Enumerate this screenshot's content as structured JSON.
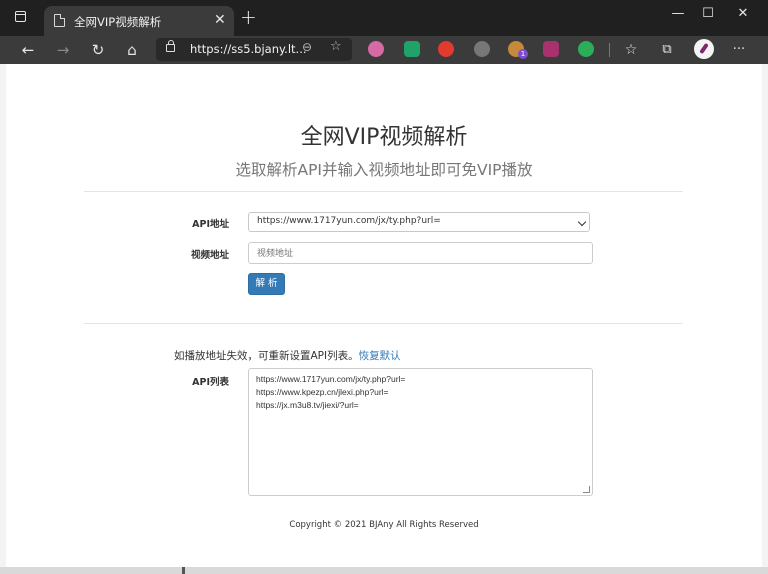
{
  "window": {
    "minimize": "—",
    "maximize": "☐",
    "close": "✕"
  },
  "tab": {
    "title": "全网VIP视频解析",
    "close": "✕",
    "new_tab": "+"
  },
  "toolbar": {
    "url": "https://ss5.bjany.lt...",
    "back": "←",
    "forward": "→",
    "refresh": "↻",
    "home": "⌂",
    "zoom": "⊖",
    "favorite": "☆",
    "collections": "☆",
    "profile_badge": "1",
    "more": "···"
  },
  "page": {
    "title": "全网VIP视频解析",
    "subtitle": "选取解析API并输入视频地址即可免VIP播放",
    "api_label": "API地址",
    "api_selected": "https://www.1717yun.com/jx/ty.php?url=",
    "video_label": "视频地址",
    "video_placeholder": "视频地址",
    "parse_button": "解 析",
    "note_text": "如播放地址失效，可重新设置API列表。",
    "reset_link": "恢复默认",
    "api_list_label": "API列表",
    "api_list": [
      "https://www.1717yun.com/jx/ty.php?url=",
      "https://www.kpezp.cn/jlexi.php?url=",
      "https://jx.m3u8.tv/jiexi/?url="
    ],
    "copyright": "Copyright © 2021 BJAny All Rights Reserved"
  }
}
